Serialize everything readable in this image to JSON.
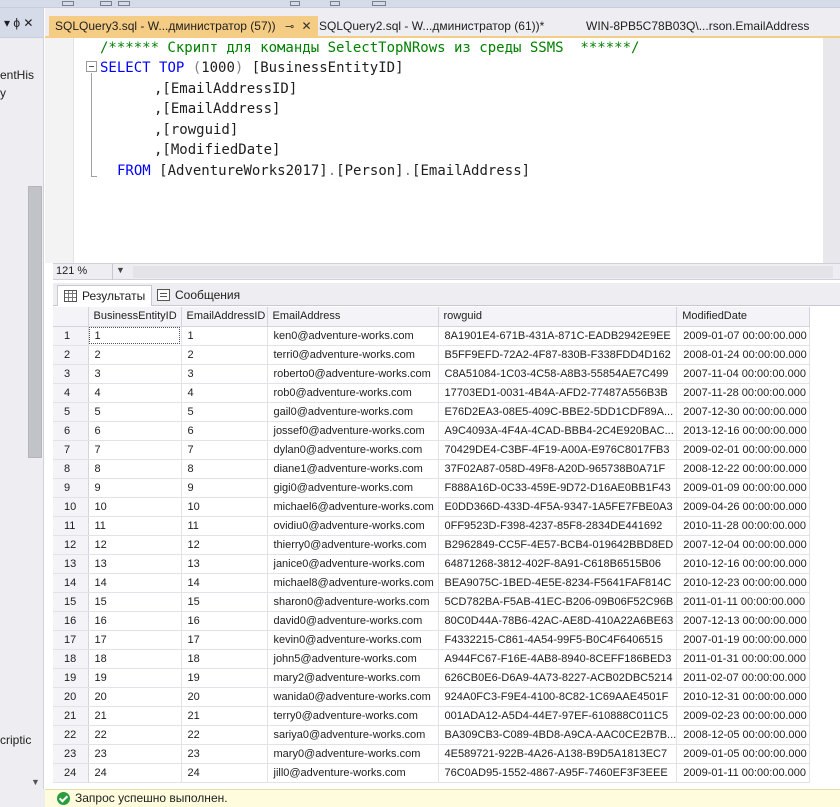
{
  "left_panel": {
    "header_text": "▾ ϕ ✕",
    "label_top": "entHis",
    "label_top2": "y",
    "label_bottom": "criptic"
  },
  "tabs": [
    {
      "label": "SQLQuery3.sql - W...дминистратор (57))",
      "active": true
    },
    {
      "label": "SQLQuery2.sql - W...дминистратор (61))*",
      "active": false
    },
    {
      "label": "WIN-8PB5C78B03Q\\...rson.EmailAddress",
      "active": false
    }
  ],
  "editor": {
    "comment": "/****** Скрипт для команды SelectTopNRows из среды SSMS  ******/",
    "line2_kw1": "SELECT",
    "line2_kw2": "TOP",
    "line2_paren_open": "(",
    "line2_num": "1000",
    "line2_paren_close": ")",
    "line2_col": "[BusinessEntityID]",
    "col_lines": [
      ",[EmailAddressID]",
      ",[EmailAddress]",
      ",[rowguid]",
      ",[ModifiedDate]"
    ],
    "from_kw": "FROM",
    "from_db": "[AdventureWorks2017]",
    "from_schema": "[Person]",
    "from_table": "[EmailAddress]"
  },
  "zoom": "121 %",
  "results_tabs": {
    "results": "Результаты",
    "messages": "Сообщения"
  },
  "columns": [
    "BusinessEntityID",
    "EmailAddressID",
    "EmailAddress",
    "rowguid",
    "ModifiedDate"
  ],
  "rows": [
    [
      "1",
      "1",
      "1",
      "ken0@adventure-works.com",
      "8A1901E4-671B-431A-871C-EADB2942E9EE",
      "2009-01-07 00:00:00.000"
    ],
    [
      "2",
      "2",
      "2",
      "terri0@adventure-works.com",
      "B5FF9EFD-72A2-4F87-830B-F338FDD4D162",
      "2008-01-24 00:00:00.000"
    ],
    [
      "3",
      "3",
      "3",
      "roberto0@adventure-works.com",
      "C8A51084-1C03-4C58-A8B3-55854AE7C499",
      "2007-11-04 00:00:00.000"
    ],
    [
      "4",
      "4",
      "4",
      "rob0@adventure-works.com",
      "17703ED1-0031-4B4A-AFD2-77487A556B3B",
      "2007-11-28 00:00:00.000"
    ],
    [
      "5",
      "5",
      "5",
      "gail0@adventure-works.com",
      "E76D2EA3-08E5-409C-BBE2-5DD1CDF89A...",
      "2007-12-30 00:00:00.000"
    ],
    [
      "6",
      "6",
      "6",
      "jossef0@adventure-works.com",
      "A9C4093A-4F4A-4CAD-BBB4-2C4E920BAC...",
      "2013-12-16 00:00:00.000"
    ],
    [
      "7",
      "7",
      "7",
      "dylan0@adventure-works.com",
      "70429DE4-C3BF-4F19-A00A-E976C8017FB3",
      "2009-02-01 00:00:00.000"
    ],
    [
      "8",
      "8",
      "8",
      "diane1@adventure-works.com",
      "37F02A87-058D-49F8-A20D-965738B0A71F",
      "2008-12-22 00:00:00.000"
    ],
    [
      "9",
      "9",
      "9",
      "gigi0@adventure-works.com",
      "F888A16D-0C33-459E-9D72-D16AE0BB1F43",
      "2009-01-09 00:00:00.000"
    ],
    [
      "10",
      "10",
      "10",
      "michael6@adventure-works.com",
      "E0DD366D-433D-4F5A-9347-1A5FE7FBE0A3",
      "2009-04-26 00:00:00.000"
    ],
    [
      "11",
      "11",
      "11",
      "ovidiu0@adventure-works.com",
      "0FF9523D-F398-4237-85F8-2834DE441692",
      "2010-11-28 00:00:00.000"
    ],
    [
      "12",
      "12",
      "12",
      "thierry0@adventure-works.com",
      "B2962849-CC5F-4E57-BCB4-019642BBD8ED",
      "2007-12-04 00:00:00.000"
    ],
    [
      "13",
      "13",
      "13",
      "janice0@adventure-works.com",
      "64871268-3812-402F-8A91-C618B6515B06",
      "2010-12-16 00:00:00.000"
    ],
    [
      "14",
      "14",
      "14",
      "michael8@adventure-works.com",
      "BEA9075C-1BED-4E5E-8234-F5641FAF814C",
      "2010-12-23 00:00:00.000"
    ],
    [
      "15",
      "15",
      "15",
      "sharon0@adventure-works.com",
      "5CD782BA-F5AB-41EC-B206-09B06F52C96B",
      "2011-01-11 00:00:00.000"
    ],
    [
      "16",
      "16",
      "16",
      "david0@adventure-works.com",
      "80C0D44A-78B6-42AC-AE8D-410A22A6BE63",
      "2007-12-13 00:00:00.000"
    ],
    [
      "17",
      "17",
      "17",
      "kevin0@adventure-works.com",
      "F4332215-C861-4A54-99F5-B0C4F6406515",
      "2007-01-19 00:00:00.000"
    ],
    [
      "18",
      "18",
      "18",
      "john5@adventure-works.com",
      "A944FC67-F16E-4AB8-8940-8CEFF186BED3",
      "2011-01-31 00:00:00.000"
    ],
    [
      "19",
      "19",
      "19",
      "mary2@adventure-works.com",
      "626CB0E6-D6A9-4A73-8227-ACB02DBC5214",
      "2011-02-07 00:00:00.000"
    ],
    [
      "20",
      "20",
      "20",
      "wanida0@adventure-works.com",
      "924A0FC3-F9E4-4100-8C82-1C69AAE4501F",
      "2010-12-31 00:00:00.000"
    ],
    [
      "21",
      "21",
      "21",
      "terry0@adventure-works.com",
      "001ADA12-A5D4-44E7-97EF-610888C011C5",
      "2009-02-23 00:00:00.000"
    ],
    [
      "22",
      "22",
      "22",
      "sariya0@adventure-works.com",
      "BA309CB3-C089-4BD8-A9CA-AAC0CE2B7B...",
      "2008-12-05 00:00:00.000"
    ],
    [
      "23",
      "23",
      "23",
      "mary0@adventure-works.com",
      "4E589721-922B-4A26-A138-B9D5A1813EC7",
      "2009-01-05 00:00:00.000"
    ],
    [
      "24",
      "24",
      "24",
      "jill0@adventure-works.com",
      "76C0AD95-1552-4867-A95F-7460EF3F3EEE",
      "2009-01-11 00:00:00.000"
    ]
  ],
  "status": {
    "message": "Запрос успешно выполнен."
  },
  "colors": {
    "active_tab": "#f5cc84",
    "keyword": "#0000ff",
    "comment": "#008000",
    "status_bg": "#fffcdd",
    "ok_icon": "#2a9d3f"
  }
}
